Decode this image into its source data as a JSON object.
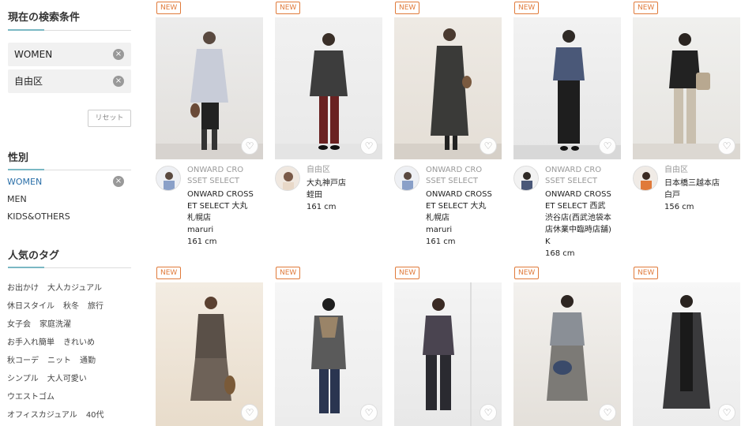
{
  "sidebar": {
    "current_conditions_title": "現在の検索条件",
    "conditions": [
      "WOMEN",
      "自由区"
    ],
    "reset_label": "リセット",
    "gender_title": "性別",
    "genders": [
      "WOMEN",
      "MEN",
      "KIDS&OTHERS"
    ],
    "tags_title": "人気のタグ",
    "tag_rows": [
      [
        "お出かけ",
        "大人カジュアル"
      ],
      [
        "休日スタイル",
        "秋冬",
        "旅行"
      ],
      [
        "女子会",
        "家庭洗濯"
      ],
      [
        "お手入れ簡単",
        "きれいめ"
      ],
      [
        "秋コーデ",
        "ニット",
        "通勤"
      ],
      [
        "シンプル",
        "大人可愛い"
      ],
      [
        "ウエストゴム"
      ],
      [
        "オフィスカジュアル",
        "40代"
      ]
    ]
  },
  "badge": "NEW",
  "heart_icon": "♡",
  "clear_icon": "×",
  "cards_row1": [
    {
      "shop_line1": "ONWARD CRO",
      "shop_line2": "SSET SELECT",
      "store": [
        "ONWARD CROSS",
        "ET SELECT 大丸",
        "札幌店"
      ],
      "staff": "maruri",
      "height": "161 cm"
    },
    {
      "shop_line1": "自由区",
      "shop_line2": "",
      "store": [
        "大丸神戸店"
      ],
      "staff": "蛭田",
      "height": "161 cm"
    },
    {
      "shop_line1": "ONWARD CRO",
      "shop_line2": "SSET SELECT",
      "store": [
        "ONWARD CROSS",
        "ET SELECT 大丸",
        "札幌店"
      ],
      "staff": "maruri",
      "height": "161 cm"
    },
    {
      "shop_line1": "ONWARD CRO",
      "shop_line2": "SSET SELECT",
      "store": [
        "ONWARD CROSS",
        "ET SELECT 西武",
        "渋谷店(西武池袋本",
        "店休業中臨時店舗)"
      ],
      "staff": "K",
      "height": "168 cm"
    },
    {
      "shop_line1": "自由区",
      "shop_line2": "",
      "store": [
        "日本橋三越本店"
      ],
      "staff": "白戸",
      "height": "156 cm"
    }
  ]
}
